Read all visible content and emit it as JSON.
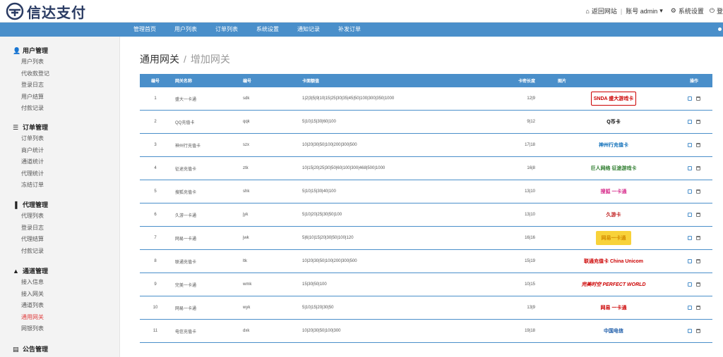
{
  "brand": {
    "name": "信达支付"
  },
  "topbar": {
    "back_label": "返回网站",
    "account_label": "账号 admin",
    "settings_label": "系统设置",
    "logout_label": "登"
  },
  "nav": [
    "管理首页",
    "用户列表",
    "订单列表",
    "系统设置",
    "通知记录",
    "补发订单"
  ],
  "sidebar": {
    "groups": [
      {
        "title": "用户管理",
        "items": [
          "用户列表",
          "代收款登记",
          "登录日志",
          "用户结算",
          "付款记录"
        ]
      },
      {
        "title": "订单管理",
        "items": [
          "订单列表",
          "商户统计",
          "通道统计",
          "代理统计",
          "冻结订单"
        ]
      },
      {
        "title": "代理管理",
        "items": [
          "代理列表",
          "登录日志",
          "代理结算",
          "付款记录"
        ]
      },
      {
        "title": "通道管理",
        "items": [
          "接入信息",
          "接入网关",
          "通道列表",
          "通用网关",
          "网银列表"
        ]
      },
      {
        "title": "公告管理",
        "items": []
      }
    ],
    "active_item": "通用网关"
  },
  "breadcrumb": {
    "parent": "通用网关",
    "separator": "/",
    "current": "增加网关"
  },
  "table": {
    "headers": {
      "id": "编号",
      "name": "网关名称",
      "code": "编号",
      "face": "卡面额值",
      "len": "卡密长度",
      "img": "图片",
      "op": "操作"
    },
    "rows": [
      {
        "id": "1",
        "name": "盛大一卡通",
        "code": "sdk",
        "face": "1|2|3|5|9|10|15|25|30|35|45|50|100|300|350|1000",
        "len": "12|9",
        "logo": "SNDA 盛大游戏卡"
      },
      {
        "id": "2",
        "name": "QQ充值卡",
        "code": "qqk",
        "face": "5|10|15|30|60|100",
        "len": "9|12",
        "logo": "Q币卡"
      },
      {
        "id": "3",
        "name": "神州行充值卡",
        "code": "szx",
        "face": "10|20|30|50|100|200|300|500",
        "len": "17|18",
        "logo": "神州行充值卡"
      },
      {
        "id": "4",
        "name": "征途充值卡",
        "code": "ztk",
        "face": "10|15|20|25|30|50|60|100|300|468|500|1000",
        "len": "16|8",
        "logo": "巨人网络 征途游戏卡"
      },
      {
        "id": "5",
        "name": "搜狐充值卡",
        "code": "shk",
        "face": "5|10|15|30|40|100",
        "len": "13|10",
        "logo": "搜狐 一卡通"
      },
      {
        "id": "6",
        "name": "久游一卡通",
        "code": "jyk",
        "face": "5|10|20|25|30|50|100",
        "len": "13|10",
        "logo": "久游卡"
      },
      {
        "id": "7",
        "name": "网易一卡通",
        "code": "jwk",
        "face": "5|6|10|15|20|30|50|100|120",
        "len": "16|16",
        "logo": "网易一卡通"
      },
      {
        "id": "8",
        "name": "联通充值卡",
        "code": "ltk",
        "face": "10|20|30|50|100|200|300|500",
        "len": "15|19",
        "logo": "联通充值卡 China Unicom"
      },
      {
        "id": "9",
        "name": "完美一卡通",
        "code": "wmk",
        "face": "15|30|50|100",
        "len": "10|15",
        "logo": "完美时空 PERFECT WORLD"
      },
      {
        "id": "10",
        "name": "网易一卡通",
        "code": "wyk",
        "face": "5|10|15|20|30|50",
        "len": "13|9",
        "logo": "网易 一卡通"
      },
      {
        "id": "11",
        "name": "电信充值卡",
        "code": "dxk",
        "face": "10|20|30|50|100|300",
        "len": "19|18",
        "logo": "中国电信"
      }
    ]
  }
}
